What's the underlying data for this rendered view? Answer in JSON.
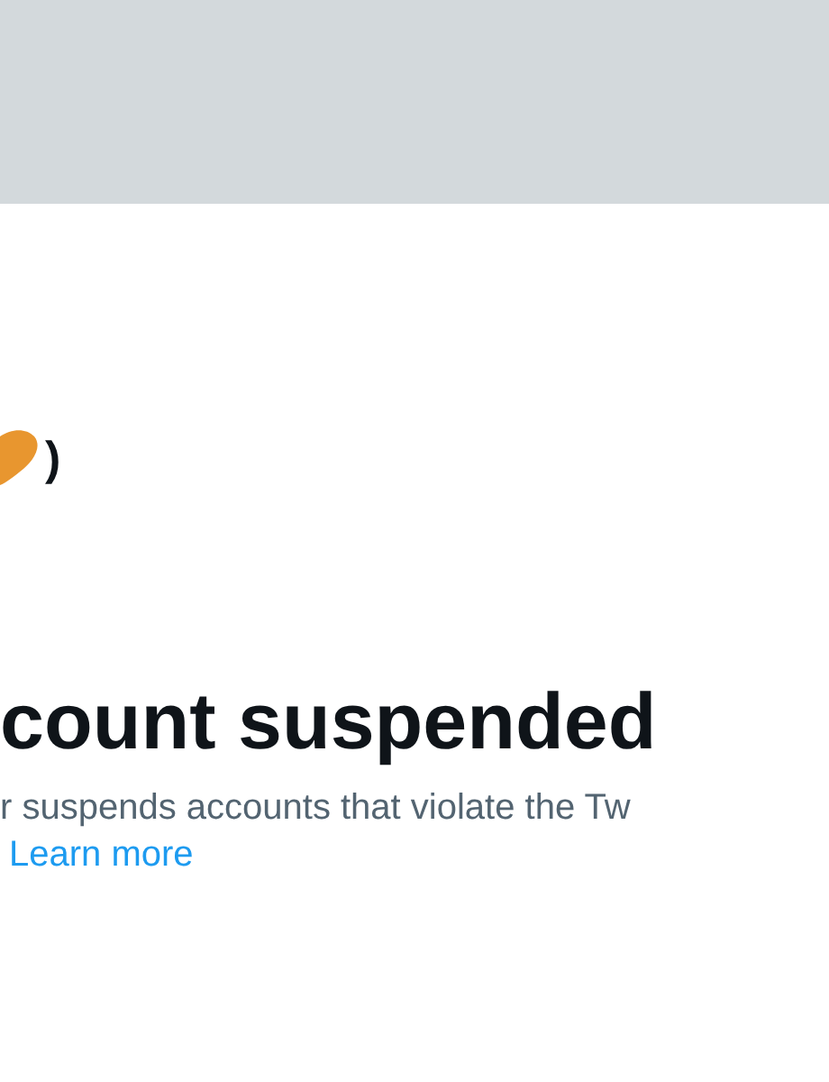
{
  "profile": {
    "name_fragment": ")"
  },
  "notice": {
    "title": "count suspended",
    "body": "r suspends accounts that violate the Tw",
    "link": "Learn more"
  }
}
